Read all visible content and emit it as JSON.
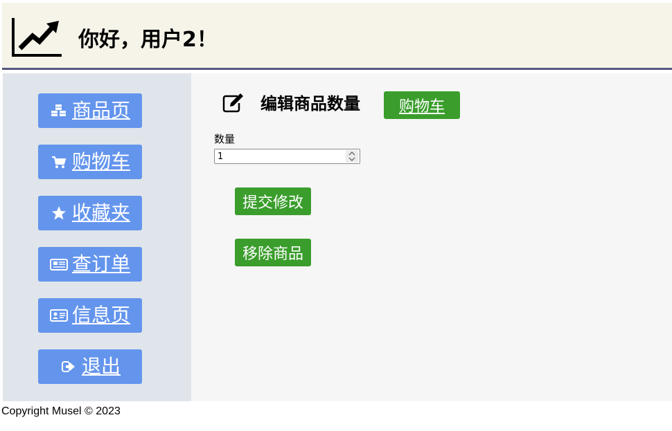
{
  "header": {
    "greeting": "你好，用户2！",
    "logo_icon": "trending-up-chart-icon"
  },
  "sidebar": {
    "items": [
      {
        "label": "商品页",
        "icon": "cubes-icon"
      },
      {
        "label": "购物车",
        "icon": "shopping-cart-icon"
      },
      {
        "label": "收藏夹",
        "icon": "star-icon"
      },
      {
        "label": "查订单",
        "icon": "newspaper-icon"
      },
      {
        "label": "信息页",
        "icon": "id-card-icon"
      },
      {
        "label": "退出",
        "icon": "sign-out-icon"
      }
    ]
  },
  "main": {
    "title": "编辑商品数量",
    "title_icon": "edit-icon",
    "cart_link": "购物车",
    "quantity_label": "数量",
    "quantity_value": "1",
    "submit_button": "提交修改",
    "remove_button": "移除商品"
  },
  "footer": {
    "copyright": "Copyright Musel © 2023"
  },
  "colors": {
    "header_bg": "#f6f4e9",
    "header_border": "#55577f",
    "sidebar_bg": "#dfe5ea",
    "nav_button": "#6495ed",
    "action_button": "#3a9d2c",
    "main_bg": "#f6f6f6"
  }
}
